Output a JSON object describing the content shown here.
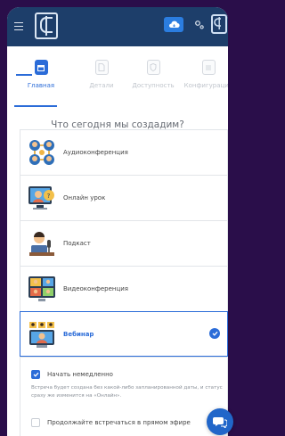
{
  "header": {
    "menu_icon": "hamburger-icon",
    "logo_icon": "app-logo-icon",
    "cloud_icon": "cloud-icon",
    "settings_icon": "gear-icon",
    "user_icon": "user-logo-icon",
    "accent": "#2b7de0",
    "bg": "#1d3e6a"
  },
  "steps": [
    {
      "label": "Главная",
      "icon": "calendar-icon",
      "active": true
    },
    {
      "label": "Детали",
      "icon": "document-icon",
      "active": false
    },
    {
      "label": "Доступность",
      "icon": "shield-icon",
      "active": false
    },
    {
      "label": "Конфигурации",
      "icon": "list-icon",
      "active": false
    }
  ],
  "question": "Что сегодня мы создадим?",
  "options": [
    {
      "label": "Аудиоконференция",
      "icon": "audio-conference-icon",
      "selected": false
    },
    {
      "label": "Онлайн урок",
      "icon": "online-lesson-icon",
      "selected": false
    },
    {
      "label": "Подкаст",
      "icon": "podcast-icon",
      "selected": false
    },
    {
      "label": "Видеоконференция",
      "icon": "video-conference-icon",
      "selected": false
    },
    {
      "label": "Вебинар",
      "icon": "webinar-icon",
      "selected": true
    }
  ],
  "settings": {
    "start_now": "Начать немедленно",
    "start_now_checked": true,
    "note": "Встреча будет создана без какой-либо запланированной даты, и статус сразу же изменится на «Онлайн».",
    "keep_live": "Продолжайте встречаться в прямом эфире",
    "keep_live_checked": false
  },
  "chat_icon": "chat-icon"
}
